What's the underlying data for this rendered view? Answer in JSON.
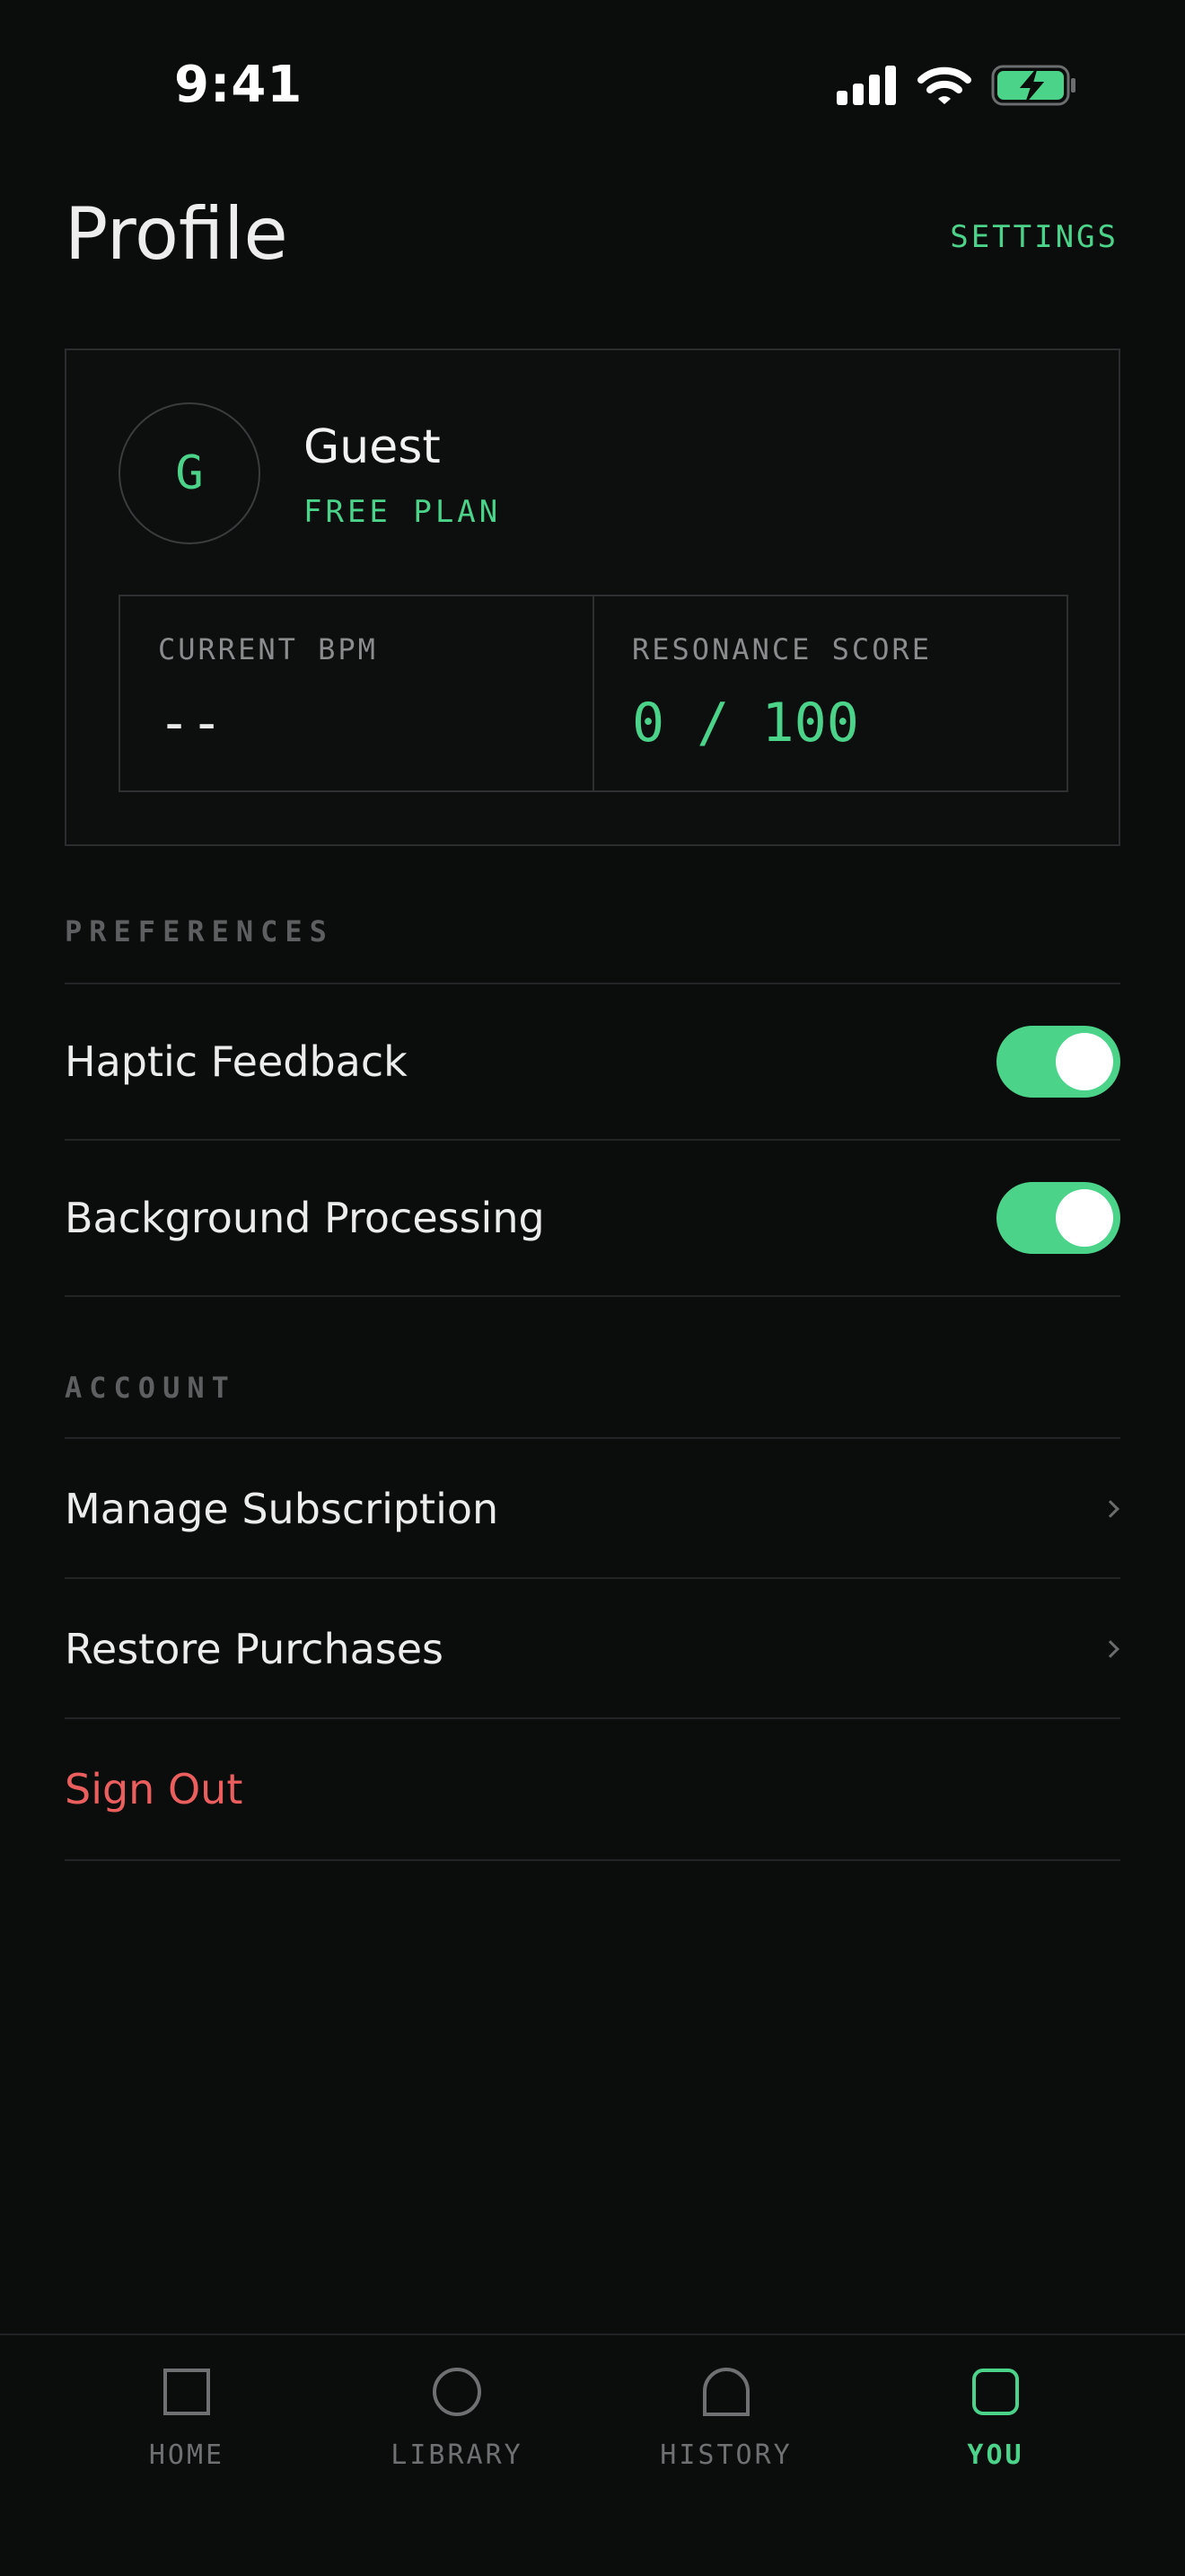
{
  "status_bar": {
    "time": "9:41",
    "icons": [
      "signal-icon",
      "wifi-icon",
      "battery-charging-icon"
    ]
  },
  "header": {
    "title": "Profile",
    "settings_label": "SETTINGS"
  },
  "profile": {
    "avatar_initial": "G",
    "name": "Guest",
    "plan": "FREE PLAN",
    "stats": [
      {
        "label": "CURRENT BPM",
        "value": "--"
      },
      {
        "label": "RESONANCE SCORE",
        "value": "0 / 100"
      }
    ]
  },
  "preferences": {
    "section_label": "PREFERENCES",
    "items": [
      {
        "label": "Haptic Feedback",
        "enabled": true
      },
      {
        "label": "Background Processing",
        "enabled": true
      }
    ]
  },
  "account": {
    "section_label": "ACCOUNT",
    "items": [
      {
        "label": "Manage Subscription"
      },
      {
        "label": "Restore Purchases"
      },
      {
        "label": "Sign Out"
      }
    ]
  },
  "tab_bar": {
    "active": "YOU",
    "tabs": [
      {
        "label": "HOME",
        "icon": "square-icon"
      },
      {
        "label": "LIBRARY",
        "icon": "circle-icon"
      },
      {
        "label": "HISTORY",
        "icon": "arch-icon"
      },
      {
        "label": "YOU",
        "icon": "rounded-square-icon"
      }
    ]
  },
  "colors": {
    "background": "#0b0c0c",
    "accent": "#4cd38a",
    "danger": "#ea5e5e",
    "muted": "#6e7071"
  }
}
